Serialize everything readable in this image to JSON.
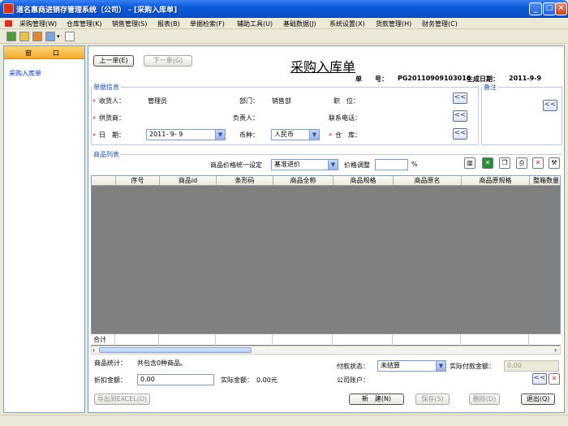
{
  "window": {
    "title": "道名惠商进销存管理系统（公司） - [采购入库单]",
    "controls": {
      "minimize": "_",
      "maximize": "□",
      "close": "✕"
    }
  },
  "menu": [
    {
      "label": "采购管理(W)"
    },
    {
      "label": "仓库管理(K)"
    },
    {
      "label": "销售管理(S)"
    },
    {
      "label": "报表(B)"
    },
    {
      "label": "单据检索(F)"
    },
    {
      "label": "辅助工具(U)"
    },
    {
      "label": "基础数据(J)"
    },
    {
      "label": "系统设置(X)"
    },
    {
      "label": "货款管理(H)"
    },
    {
      "label": "财务管理(C)"
    }
  ],
  "left_panel": {
    "header_left": "窗",
    "header_right": "口",
    "items": [
      "采购入库单"
    ]
  },
  "doc": {
    "prev_button": "上一单(E)",
    "next_button": "下一单(G)",
    "title": "采购入库单",
    "number_label": "单　　号：",
    "number_value": "PG20110909103016",
    "date_label": "生成日期：",
    "date_value": "2011-9-9"
  },
  "info": {
    "group_title": "单据信息",
    "remark_title": "备注",
    "receiver_label": "收货人：",
    "receiver_value": "管理员",
    "dept_label": "部门：",
    "dept_value": "销售部",
    "position_label": "职　位：",
    "position_value": "",
    "supplier_label": "供货商：",
    "supplier_value": "",
    "manager_label": "负责人：",
    "manager_value": "",
    "phone_label": "联系电话：",
    "phone_value": "",
    "date_label": "日　期：",
    "date_value": "2011- 9- 9",
    "currency_label": "币种：",
    "currency_value": "人民币",
    "warehouse_label": "仓　库：",
    "warehouse_value": "",
    "pick_symbol": "<<",
    "required_mark": "*"
  },
  "goods": {
    "group_title": "商品列表",
    "price_unify_label": "商品价格统一设定",
    "price_unify_value": "基准进价",
    "price_adjust_label": "价格调整",
    "price_adjust_value": "",
    "percent": "%",
    "columns": [
      "序号",
      "商品id",
      "条形码",
      "商品全称",
      "商品规格",
      "商品原名",
      "商品原规格",
      "整箱数量"
    ],
    "footer_label": "合计",
    "toolbar_icons": [
      "barcode-icon",
      "excel-icon",
      "copy-icon",
      "print-icon",
      "delete-icon",
      "tools-icon"
    ]
  },
  "summary": {
    "stat_label": "商品统计：",
    "stat_value": "共包含0种商品。",
    "pay_status_label": "付款状态：",
    "pay_status_value": "未结算",
    "actual_pay_label": "实际付款金额：",
    "actual_pay_value": "0.00",
    "discount_label": "折扣金额：",
    "discount_value": "0.00",
    "actual_amount_label": "实际金额：",
    "actual_amount_value": "0.00元",
    "account_label": "公司账户："
  },
  "actions": {
    "export": "导出到EXCEL(O)",
    "new": "新　建(N)",
    "save": "保存(S)",
    "delete": "删除(D)",
    "exit": "退出(Q)"
  },
  "colors": {
    "titlebar": "#0A5BD9",
    "accent": "#1c4fb0",
    "grid_bg": "#808080",
    "required": "#d02020"
  }
}
